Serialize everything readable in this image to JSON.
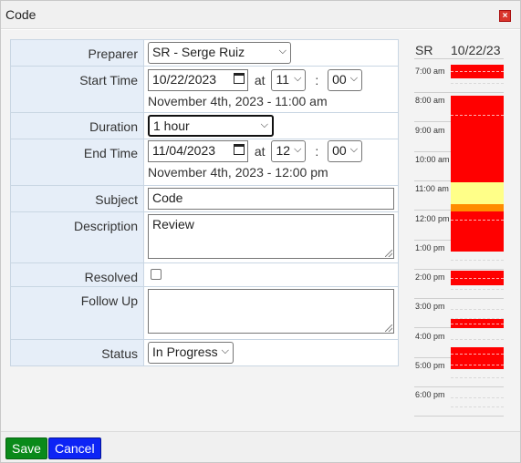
{
  "window": {
    "title": "Code",
    "close_glyph": "×"
  },
  "form": {
    "preparer": {
      "label": "Preparer",
      "value": "SR - Serge Ruiz"
    },
    "start": {
      "label": "Start Time",
      "date": "10/22/2023",
      "at": "at",
      "hour": "11",
      "sep": ":",
      "minute": "00",
      "text": "November 4th, 2023 - 11:00 am"
    },
    "duration": {
      "label": "Duration",
      "value": "1 hour"
    },
    "end": {
      "label": "End Time",
      "date": "11/04/2023",
      "at": "at",
      "hour": "12",
      "sep": ":",
      "minute": "00",
      "text": "November 4th, 2023 - 12:00 pm"
    },
    "subject": {
      "label": "Subject",
      "value": "Code"
    },
    "description": {
      "label": "Description",
      "value": "Review"
    },
    "resolved": {
      "label": "Resolved",
      "checked": false
    },
    "follow_up": {
      "label": "Follow Up",
      "value": ""
    },
    "status": {
      "label": "Status",
      "value": "In Progress"
    }
  },
  "schedule": {
    "initials": "SR",
    "date": "10/22/23",
    "hours": [
      "7:00 am",
      "8:00 am",
      "9:00 am",
      "10:00 am",
      "11:00 am",
      "12:00 pm",
      "1:00 pm",
      "2:00 pm",
      "3:00 pm",
      "4:00 pm",
      "5:00 pm",
      "6:00 pm"
    ],
    "colors": {
      "booked": "#ff0000",
      "selected": "#ffff88",
      "overlap": "#ff8c00"
    }
  },
  "footer": {
    "save_label": "Save",
    "cancel_label": "Cancel"
  },
  "icons": {
    "caret": "chevron-down-icon",
    "calendar": "calendar-icon",
    "close": "close-icon"
  }
}
